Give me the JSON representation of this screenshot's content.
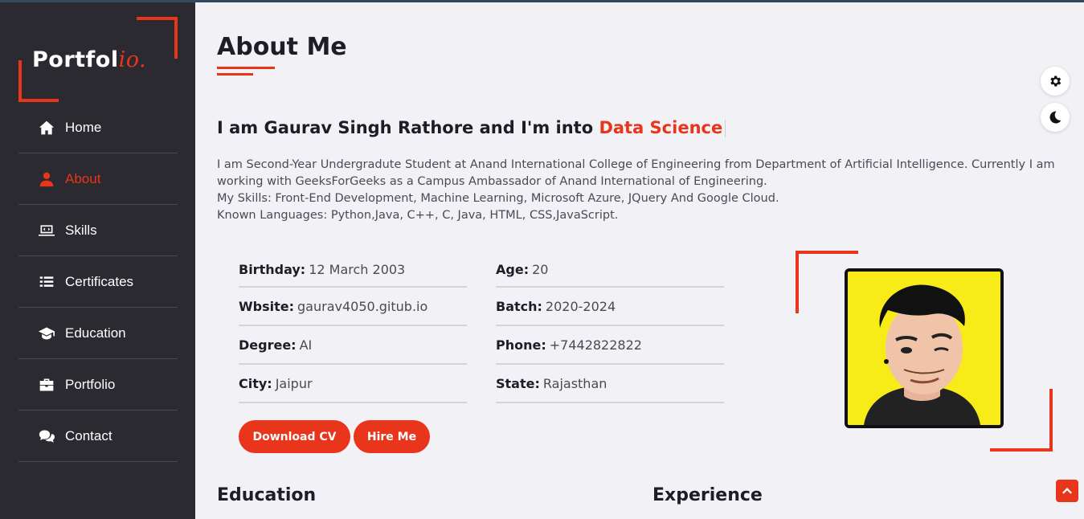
{
  "brand": {
    "name": "Portfol",
    "accent": "io."
  },
  "nav": [
    {
      "label": "Home",
      "icon": "home-icon",
      "active": false
    },
    {
      "label": "About",
      "icon": "user-icon",
      "active": true
    },
    {
      "label": "Skills",
      "icon": "laptop-code-icon",
      "active": false
    },
    {
      "label": "Certificates",
      "icon": "list-icon",
      "active": false
    },
    {
      "label": "Education",
      "icon": "graduation-cap-icon",
      "active": false
    },
    {
      "label": "Portfolio",
      "icon": "briefcase-icon",
      "active": false
    },
    {
      "label": "Contact",
      "icon": "comments-icon",
      "active": false
    }
  ],
  "about": {
    "title": "About Me",
    "tagline_prefix": "I am Gaurav Singh Rathore and I'm into ",
    "tagline_highlight": "Data Science",
    "bio": [
      "I am Second-Year Undergradute Student at Anand International College of Engineering from Department of Artificial Intelligence. Currently I am working with GeeksForGeeks as a Campus Ambassador of Anand International of Engineering.",
      "My Skills: Front-End Development, Machine Learning, Microsoft Azure, JQuery And Google Cloud.",
      "Known Languages: Python,Java, C++, C, Java, HTML, CSS,JavaScript."
    ],
    "info": [
      {
        "key": "Birthday:",
        "value": "12 March 2003"
      },
      {
        "key": "Age:",
        "value": "20"
      },
      {
        "key": "Wbsite:",
        "value": "gaurav4050.gitub.io"
      },
      {
        "key": "Batch:",
        "value": "2020-2024"
      },
      {
        "key": "Degree:",
        "value": "AI"
      },
      {
        "key": "Phone:",
        "value": "+7442822822"
      },
      {
        "key": "City:",
        "value": "Jaipur"
      },
      {
        "key": "State:",
        "value": "Rajasthan"
      }
    ],
    "download_cv": "Download CV",
    "hire_me": "Hire Me"
  },
  "sections": {
    "education": "Education",
    "experience": "Experience"
  },
  "colors": {
    "accent": "#e8351b",
    "sidebar": "#2a2a30",
    "background": "#f1f1f6"
  }
}
